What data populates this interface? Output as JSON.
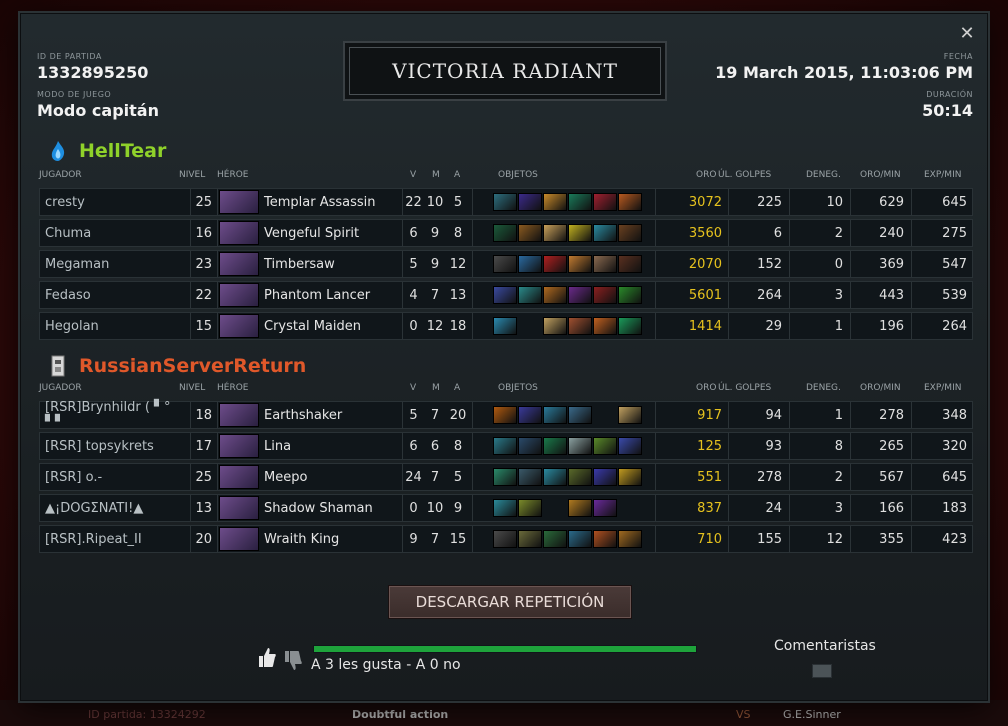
{
  "header": {
    "match_id_label": "ID DE PARTIDA",
    "match_id": "1332895250",
    "game_mode_label": "MODO DE JUEGO",
    "game_mode": "Modo capitán",
    "result": "VICTORIA RADIANT",
    "date_label": "FECHA",
    "date": "19 March 2015, 11:03:06 PM",
    "duration_label": "DURACIÓN",
    "duration": "50:14"
  },
  "columns": {
    "player": "JUGADOR",
    "level": "NIVEL",
    "hero": "HÉROE",
    "kills": "V",
    "deaths": "M",
    "assists": "A",
    "items": "OBJETOS",
    "gold": "ORO",
    "last_hits": "ÚL. GOLPES",
    "denies": "DENEG.",
    "gpm": "ORO/MIN",
    "xpm": "EXP/MIN"
  },
  "teams": [
    {
      "name": "HellTear",
      "color": "#8fd12a",
      "logo": "blue-flame-icon",
      "players": [
        {
          "player": "cresty",
          "level": "25",
          "hero": "Templar Assassin",
          "k": "22",
          "d": "10",
          "a": "5",
          "gold": "3072",
          "lh": "225",
          "dn": "10",
          "gpm": "629",
          "xpm": "645",
          "items": [
            "#2d6e7e",
            "#3b2a8a",
            "#c88a2a",
            "#1a7a5a",
            "#a02030",
            "#b85a20"
          ]
        },
        {
          "player": "Chuma",
          "level": "16",
          "hero": "Vengeful Spirit",
          "k": "6",
          "d": "9",
          "a": "8",
          "gold": "3560",
          "lh": "6",
          "dn": "2",
          "gpm": "240",
          "xpm": "275",
          "items": [
            "#1b5a3a",
            "#8a5a20",
            "#c8a05a",
            "#c0b020",
            "#2a8aa0",
            "#6a4020"
          ]
        },
        {
          "player": "Megaman",
          "level": "23",
          "hero": "Timbersaw",
          "k": "5",
          "d": "9",
          "a": "12",
          "gold": "2070",
          "lh": "152",
          "dn": "0",
          "gpm": "369",
          "xpm": "547",
          "items": [
            "#4a4a4a",
            "#2a6aa0",
            "#b02020",
            "#c07a30",
            "#8a6a50",
            "#5a3020"
          ]
        },
        {
          "player": "Fedaso",
          "level": "22",
          "hero": "Phantom Lancer",
          "k": "4",
          "d": "7",
          "a": "13",
          "gold": "5601",
          "lh": "264",
          "dn": "3",
          "gpm": "443",
          "xpm": "539",
          "items": [
            "#3a4aa0",
            "#2a8a8a",
            "#b06a20",
            "#6a2a8a",
            "#8a2020",
            "#2a8a2a"
          ]
        },
        {
          "player": "Hegolan",
          "level": "15",
          "hero": "Crystal Maiden",
          "k": "0",
          "d": "12",
          "a": "18",
          "gold": "1414",
          "lh": "29",
          "dn": "1",
          "gpm": "196",
          "xpm": "264",
          "items": [
            "#2a8ab0",
            "empty",
            "#c0a060",
            "#a05030",
            "#c06020",
            "#1a9a5a"
          ]
        }
      ]
    },
    {
      "name": "RussianServerReturn",
      "color": "#e0582a",
      "logo": "team-logo-icon",
      "players": [
        {
          "player": "[RSR]Brynhildr ( ▘° ▘▘",
          "level": "18",
          "hero": "Earthshaker",
          "k": "5",
          "d": "7",
          "a": "20",
          "gold": "917",
          "lh": "94",
          "dn": "1",
          "gpm": "278",
          "xpm": "348",
          "items": [
            "#b05a10",
            "#3a3a9a",
            "#2a7a9a",
            "#3a6a8a",
            "empty",
            "#c0a060"
          ]
        },
        {
          "player": "[RSR] topsykrets",
          "level": "17",
          "hero": "Lina",
          "k": "6",
          "d": "6",
          "a": "8",
          "gold": "125",
          "lh": "93",
          "dn": "8",
          "gpm": "265",
          "xpm": "320",
          "items": [
            "#2a7a8a",
            "#2a4a6a",
            "#1a7a4a",
            "#8aa0a0",
            "#5a8a2a",
            "#3a4aaa"
          ]
        },
        {
          "player": "[RSR]   o.-",
          "level": "25",
          "hero": "Meepo",
          "k": "24",
          "d": "7",
          "a": "5",
          "gold": "551",
          "lh": "278",
          "dn": "2",
          "gpm": "567",
          "xpm": "645",
          "items": [
            "#2a8a6a",
            "#3a5a6a",
            "#2a8aa0",
            "#5a6a2a",
            "#3a3aaa",
            "#c09a20"
          ]
        },
        {
          "player": "▲¡DOGΣNATI!▲",
          "level": "13",
          "hero": "Shadow Shaman",
          "k": "0",
          "d": "10",
          "a": "9",
          "gold": "837",
          "lh": "24",
          "dn": "3",
          "gpm": "166",
          "xpm": "183",
          "items": [
            "#2a8a9a",
            "#7a8a2a",
            "empty",
            "#b07a20",
            "#6a2a9a",
            "empty"
          ]
        },
        {
          "player": "[RSR].Ripeat_II",
          "level": "20",
          "hero": "Wraith King",
          "k": "9",
          "d": "7",
          "a": "15",
          "gold": "710",
          "lh": "155",
          "dn": "12",
          "gpm": "355",
          "xpm": "423",
          "items": [
            "#4a4a4a",
            "#6a6a3a",
            "#2a6a3a",
            "#2a6a8a",
            "#b05020",
            "#a06a20"
          ]
        }
      ]
    }
  ],
  "download_button": "DESCARGAR REPETICIÓN",
  "votes": {
    "text": "A 3 les gusta - A 0 no",
    "like_ratio": 1.0
  },
  "commentators_label": "Comentaristas",
  "colors": {
    "gold": "#e6c21e",
    "progress": "#1ea33b"
  },
  "background": {
    "match_text": "ID partida: 13324292",
    "doubtful": "Doubtful action",
    "vs": "VS",
    "sinner": "G.E.Sinner"
  }
}
